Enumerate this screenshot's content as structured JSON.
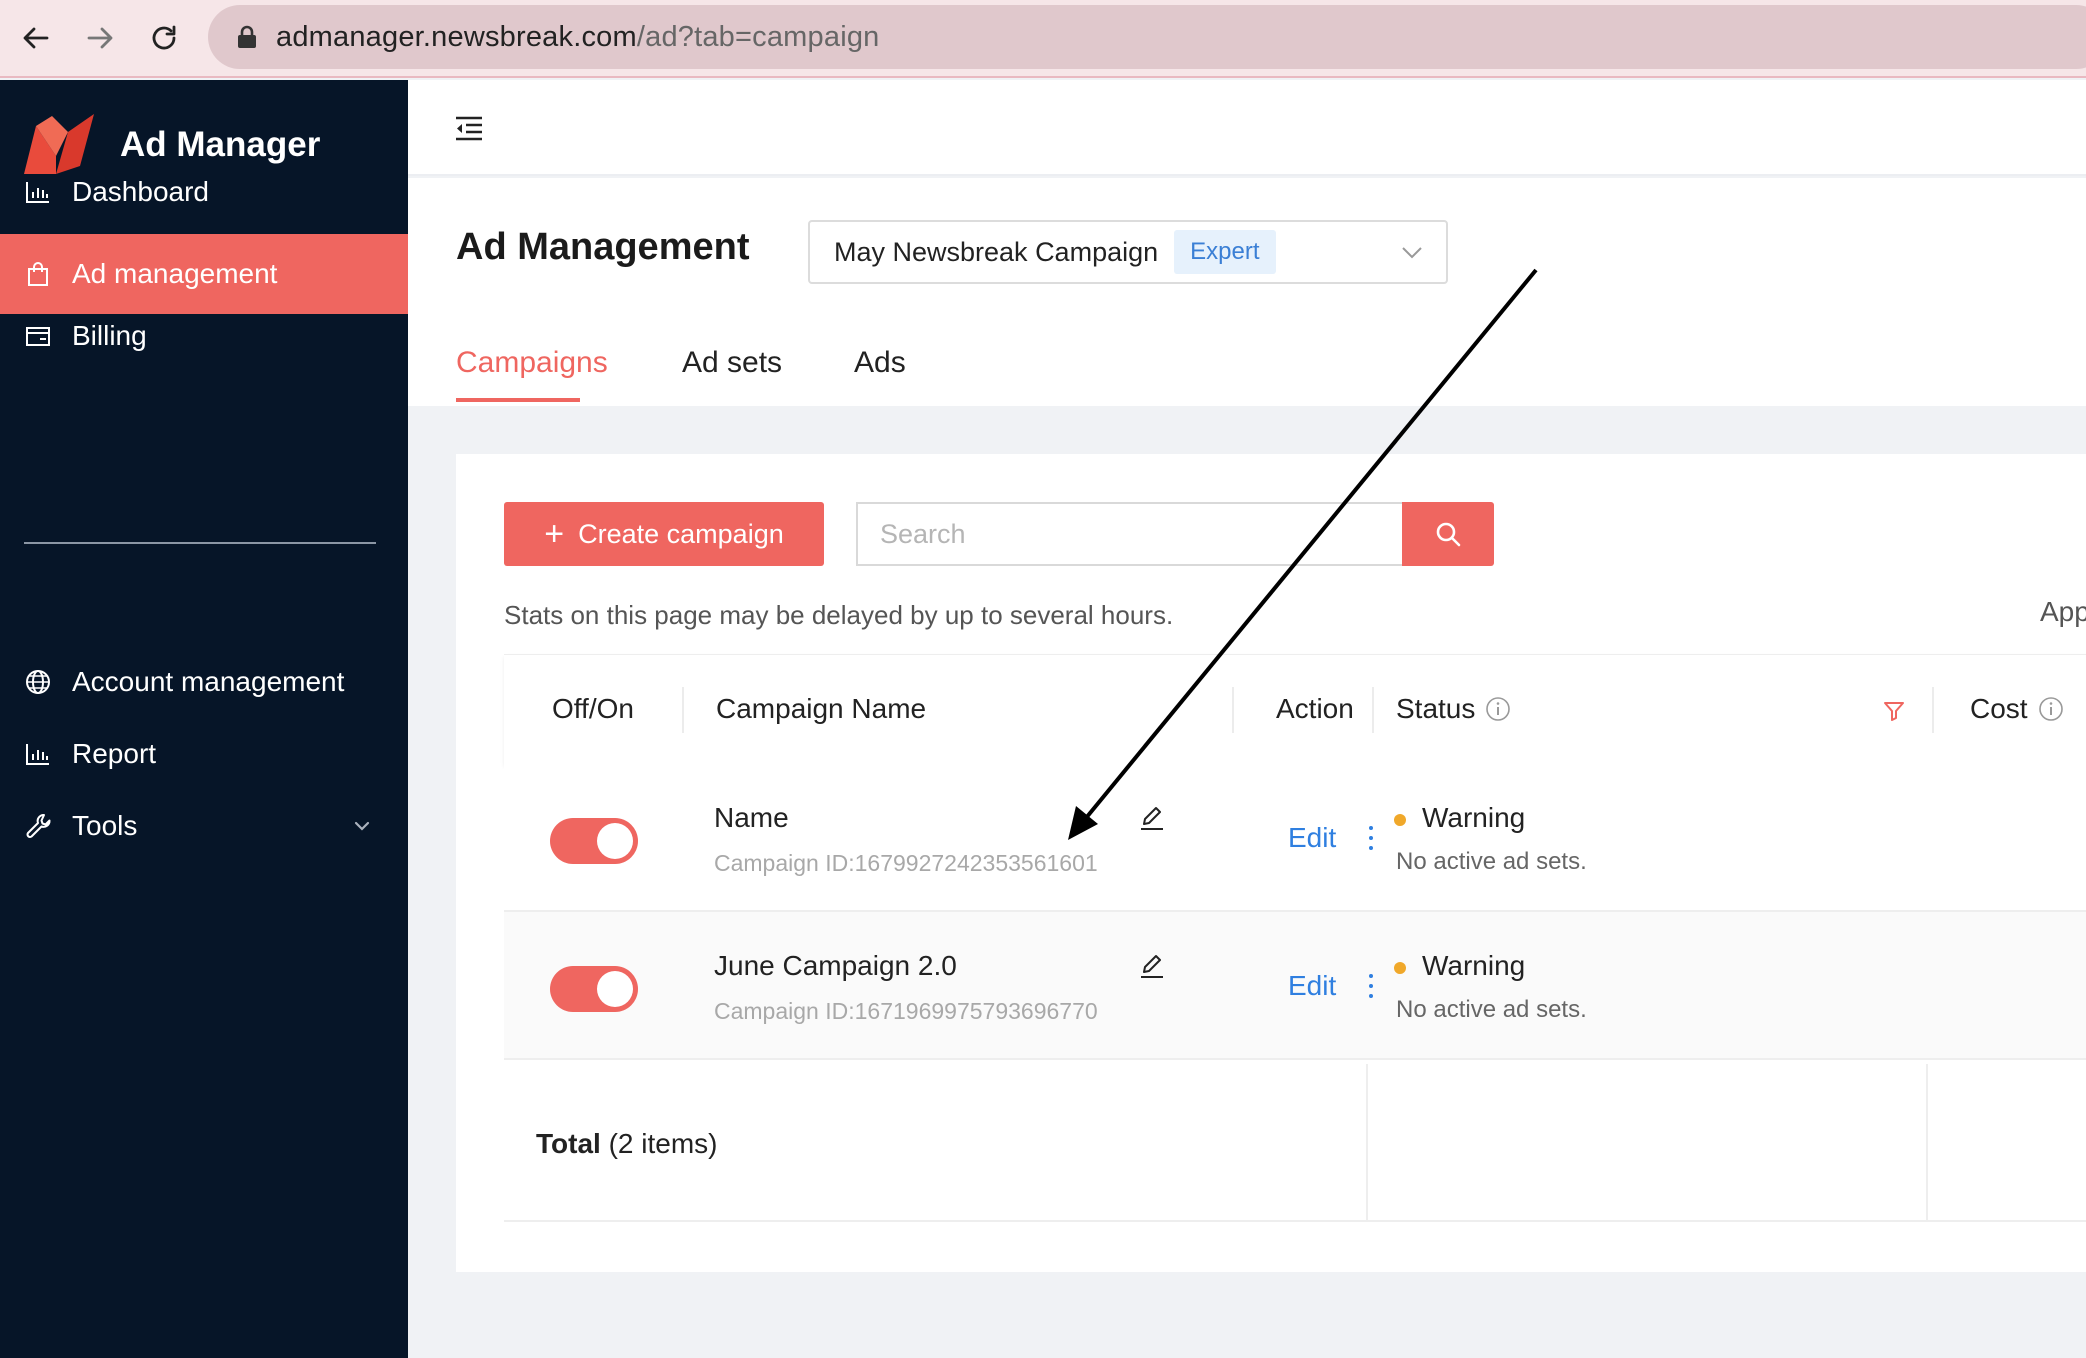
{
  "browser": {
    "url_host": "admanager.newsbreak.com",
    "url_path": "/ad?tab=campaign"
  },
  "sidebar": {
    "brand": "Ad Manager",
    "items": [
      {
        "label": "Dashboard",
        "icon": "bar-chart-icon"
      },
      {
        "label": "Ad management",
        "icon": "shopping-bag-icon",
        "active": true
      },
      {
        "label": "Billing",
        "icon": "wallet-icon"
      },
      {
        "label": "Account management",
        "icon": "globe-icon"
      },
      {
        "label": "Report",
        "icon": "bar-chart-icon"
      },
      {
        "label": "Tools",
        "icon": "wrench-icon"
      }
    ]
  },
  "header": {
    "title": "Ad Management",
    "campaign_select": "May Newsbreak Campaign",
    "badge": "Expert",
    "tabs": [
      "Campaigns",
      "Ad sets",
      "Ads"
    ]
  },
  "toolbar": {
    "create_label": "Create campaign",
    "search_placeholder": "Search",
    "note": "Stats on this page may be delayed by up to several hours.",
    "app_text": "App"
  },
  "table": {
    "columns": [
      "Off/On",
      "Campaign Name",
      "Action",
      "Status",
      "Cost"
    ],
    "rows": [
      {
        "name": "Name",
        "id": "Campaign ID:1679927242353561601",
        "action": "Edit",
        "status": "Warning",
        "status_desc": "No active ad sets.",
        "on": true
      },
      {
        "name": "June Campaign 2.0",
        "id": "Campaign ID:1671969975793696770",
        "action": "Edit",
        "status": "Warning",
        "status_desc": "No active ad sets.",
        "on": true
      }
    ],
    "total_label": "Total",
    "total_count": "(2 items)"
  },
  "colors": {
    "accent": "#ef6660",
    "sidebar_bg": "#061528",
    "link": "#2f7fe0",
    "warning": "#f0a82a"
  }
}
